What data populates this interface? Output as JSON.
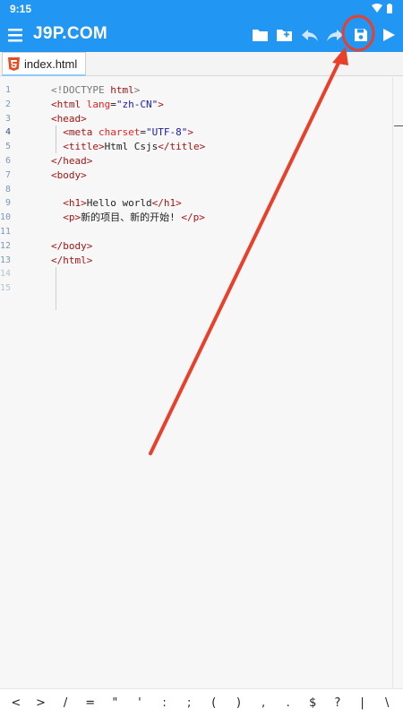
{
  "status_bar": {
    "time": "9:15"
  },
  "app_bar": {
    "title": "J9P.COM",
    "toolbar_icons": [
      "menu-icon",
      "folder-icon",
      "new-folder-icon",
      "undo-icon",
      "redo-icon",
      "save-icon",
      "run-icon"
    ]
  },
  "tabs": [
    {
      "label": "index.html",
      "icon": "html5-icon",
      "active": true
    }
  ],
  "editor": {
    "line_numbers": [
      "1",
      "2",
      "3",
      "4",
      "5",
      "6",
      "7",
      "8",
      "9",
      "10",
      "11",
      "12",
      "13",
      "14",
      "15"
    ],
    "active_line": "4",
    "lines": [
      {
        "parts": [
          {
            "t": "doc",
            "s": "<!DOCTYPE "
          },
          {
            "t": "tag",
            "s": "html"
          },
          {
            "t": "doc",
            "s": ">"
          }
        ]
      },
      {
        "parts": [
          {
            "t": "tag",
            "s": "<html "
          },
          {
            "t": "attr",
            "s": "lang"
          },
          {
            "t": "plain",
            "s": "="
          },
          {
            "t": "val",
            "s": "\"zh-CN\""
          },
          {
            "t": "tag",
            "s": ">"
          }
        ]
      },
      {
        "parts": [
          {
            "t": "tag",
            "s": "<head>"
          }
        ]
      },
      {
        "parts": [
          {
            "t": "plain",
            "s": "  "
          },
          {
            "t": "tag",
            "s": "<meta "
          },
          {
            "t": "attr",
            "s": "charset"
          },
          {
            "t": "plain",
            "s": "="
          },
          {
            "t": "val",
            "s": "\"UTF-8\""
          },
          {
            "t": "tag",
            "s": ">"
          }
        ]
      },
      {
        "parts": [
          {
            "t": "plain",
            "s": "  "
          },
          {
            "t": "tag",
            "s": "<title>"
          },
          {
            "t": "plain",
            "s": "Html Csjs"
          },
          {
            "t": "tag",
            "s": "</title>"
          }
        ]
      },
      {
        "parts": [
          {
            "t": "tag",
            "s": "</head>"
          }
        ]
      },
      {
        "parts": [
          {
            "t": "tag",
            "s": "<body>"
          }
        ]
      },
      {
        "parts": [
          {
            "t": "plain",
            "s": ""
          }
        ]
      },
      {
        "parts": [
          {
            "t": "plain",
            "s": "  "
          },
          {
            "t": "tag",
            "s": "<h1>"
          },
          {
            "t": "plain",
            "s": "Hello world"
          },
          {
            "t": "tag",
            "s": "</h1>"
          }
        ]
      },
      {
        "parts": [
          {
            "t": "plain",
            "s": "  "
          },
          {
            "t": "tag",
            "s": "<p>"
          },
          {
            "t": "plain",
            "s": "新的项目、新的开始! "
          },
          {
            "t": "tag",
            "s": "</p>"
          }
        ]
      },
      {
        "parts": [
          {
            "t": "plain",
            "s": ""
          }
        ]
      },
      {
        "parts": [
          {
            "t": "tag",
            "s": "</body>"
          }
        ]
      },
      {
        "parts": [
          {
            "t": "tag",
            "s": "</html>"
          }
        ]
      },
      {
        "parts": [
          {
            "t": "plain",
            "s": ""
          }
        ]
      },
      {
        "parts": [
          {
            "t": "plain",
            "s": ""
          }
        ]
      }
    ]
  },
  "symbol_bar": {
    "keys": [
      "<",
      ">",
      "/",
      "=",
      "\"",
      "'",
      ":",
      ";",
      "(",
      ")",
      ",",
      ".",
      "$",
      "?",
      "|",
      "\\"
    ]
  },
  "colors": {
    "primary": "#2196f3",
    "annotation": "#e8402a"
  }
}
